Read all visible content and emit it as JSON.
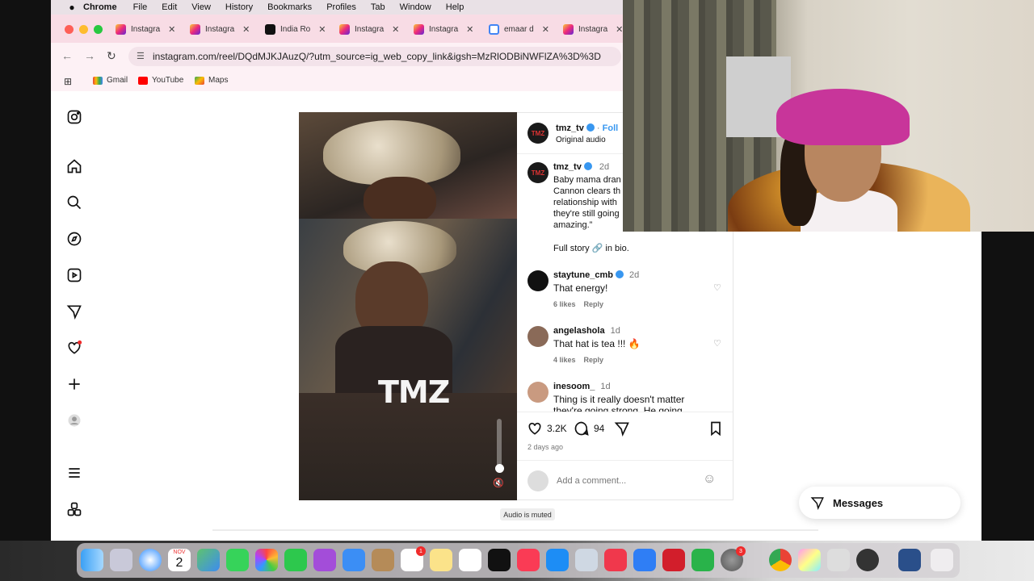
{
  "menubar": {
    "app": "Chrome",
    "items": [
      "File",
      "Edit",
      "View",
      "History",
      "Bookmarks",
      "Profiles",
      "Tab",
      "Window",
      "Help"
    ]
  },
  "tabs": [
    {
      "label": "Instagra",
      "icon": "instagram-icon"
    },
    {
      "label": "Instagra",
      "icon": "instagram-icon"
    },
    {
      "label": "India Ro",
      "icon": "tiktok-icon"
    },
    {
      "label": "Instagra",
      "icon": "instagram-icon"
    },
    {
      "label": "Instagra",
      "icon": "instagram-icon"
    },
    {
      "label": "emaar d",
      "icon": "google-icon"
    },
    {
      "label": "Instagra",
      "icon": "instagram-icon"
    }
  ],
  "toolbar": {
    "url": "instagram.com/reel/DQdMJKJAuzQ/?utm_source=ig_web_copy_link&igsh=MzRlODBiNWFlZA%3D%3D"
  },
  "bookmarks": [
    {
      "label": "Gmail",
      "icon": "gmail-icon"
    },
    {
      "label": "YouTube",
      "icon": "youtube-icon"
    },
    {
      "label": "Maps",
      "icon": "maps-icon"
    }
  ],
  "video": {
    "watermark": "TMZ",
    "tooltip": "Audio is muted"
  },
  "post": {
    "header_user": "tmz_tv",
    "follow": "Foll",
    "audio": "Original audio",
    "caption_user": "tmz_tv",
    "caption_age": "2d",
    "caption_lines": [
      "Baby mama dran",
      "Cannon clears th",
      "relationship with",
      "they're still going",
      "amazing.”"
    ],
    "caption_footer": "Full story 🔗 in bio.",
    "avatar_text": "TMZ"
  },
  "comments": [
    {
      "user": "staytune_cmb",
      "verified": true,
      "age": "2d",
      "text": "That energy!",
      "likes": "6 likes",
      "reply": "Reply"
    },
    {
      "user": "angelashola",
      "verified": false,
      "age": "1d",
      "text": "That hat is tea !!! 🔥",
      "likes": "4 likes",
      "reply": "Reply"
    },
    {
      "user": "inesoom_",
      "verified": false,
      "age": "1d",
      "text": "Thing is it really doesn't matter",
      "text2": "they're going strong. He going"
    }
  ],
  "actions": {
    "likes": "3.2K",
    "comments": "94",
    "posted": "2 days ago",
    "add_comment_placeholder": "Add a comment..."
  },
  "messages": {
    "label": "Messages"
  },
  "dock": {
    "calendar_month": "NOV",
    "calendar_day": "2",
    "reminders_badge": "1",
    "settings_badge": "3",
    "icons": [
      "finder-icon",
      "launchpad-icon",
      "safari-icon",
      "calendar-icon",
      "maps-icon",
      "messages-icon",
      "photos-icon",
      "facetime-icon",
      "podcasts-icon",
      "mail-icon",
      "contacts-icon",
      "reminders-icon",
      "notes-icon",
      "freeform-icon",
      "apple-tv-icon",
      "music-icon",
      "app-store-icon",
      "preview-icon",
      "news-icon",
      "keynote-icon",
      "photo-booth-icon",
      "numbers-icon",
      "system-settings-icon",
      "chrome-icon",
      "screenshot-icon",
      "notes-app-icon",
      "obs-icon",
      "display-icon",
      "trash-icon"
    ]
  },
  "colors": {
    "tabbar": "#f8dce5",
    "instagram_accent": "#ee2a7b",
    "verified_blue": "#3897f0",
    "notification_red": "#f02b2b"
  }
}
